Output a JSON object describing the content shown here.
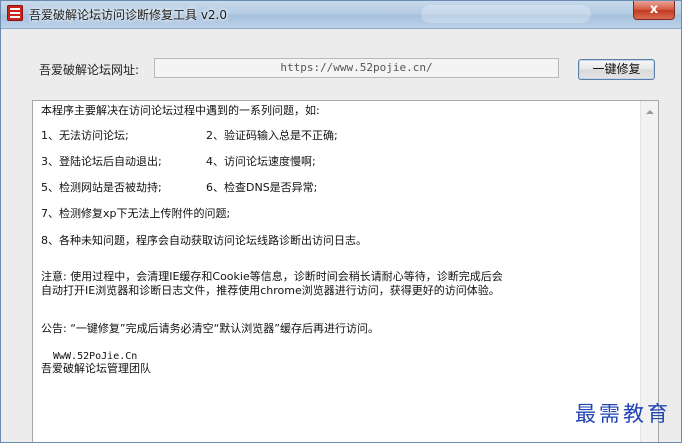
{
  "window": {
    "title": "吾爱破解论坛访问诊断修复工具 v2.0",
    "close_symbol": "x"
  },
  "url_row": {
    "label": "吾爱破解论坛网址:",
    "value": "https://www.52pojie.cn/",
    "button_label": "一键修复"
  },
  "text_area": {
    "intro": "本程序主要解决在访问论坛过程中遇到的一系列问题，如:",
    "items": [
      [
        "1、无法访问论坛;",
        "2、验证码输入总是不正确;"
      ],
      [
        "3、登陆论坛后自动退出;",
        "4、访问论坛速度慢啊;"
      ],
      [
        "5、检测网站是否被劫持;",
        "6、检查DNS是否异常;"
      ]
    ],
    "item7": "7、检测修复xp下无法上传附件的问题;",
    "item8": "8、各种未知问题，程序会自动获取访问论坛线路诊断出访问日志。",
    "notice_line1": "注意: 使用过程中，会清理IE缓存和Cookie等信息，诊断时间会稍长请耐心等待，诊断完成后会",
    "notice_line2": "自动打开IE浏览器和诊断日志文件，推荐使用chrome浏览器进行访问，获得更好的访问体验。",
    "announcement": "公告: “一键修复”完成后请务必清空“默认浏览器”缓存后再进行访问。",
    "site": "WwW.52PoJie.Cn",
    "team": "吾爱破解论坛管理团队"
  },
  "watermark": "最需教育",
  "icons": {
    "app": "app-logo-icon",
    "close": "close-icon",
    "scroll_up": "scroll-up-arrow-icon"
  },
  "colors": {
    "title_bar": "#b5cbe3",
    "close_button": "#c23a22",
    "watermark": "#2246b4",
    "window_bg": "#ececec"
  }
}
